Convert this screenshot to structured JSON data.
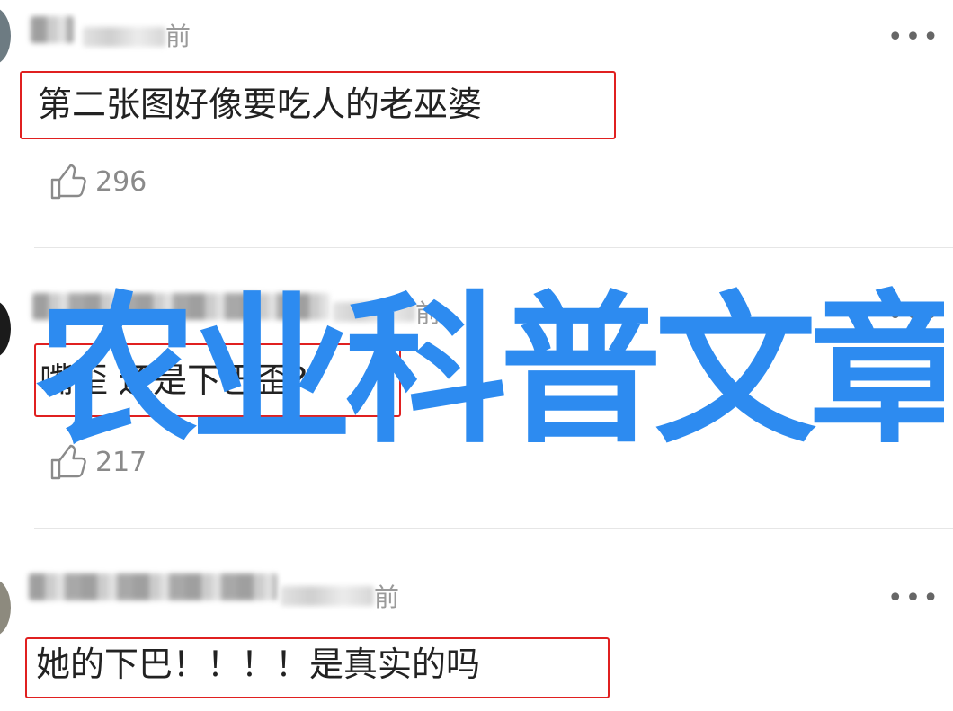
{
  "comments": [
    {
      "time_suffix": "前",
      "more_label": "•••",
      "text": "第二张图好像要吃人的老巫婆",
      "likes": "296"
    },
    {
      "time_suffix": "前",
      "more_label": "•••",
      "text": "嘴歪 还是下巴歪?",
      "likes": "217"
    },
    {
      "time_suffix": "前",
      "more_label": "•••",
      "text": "她的下巴！！！！是真实的吗",
      "likes": ""
    }
  ],
  "watermark": {
    "text": "农业科普文章",
    "color": "#2d8bf0"
  },
  "colors": {
    "highlight_border": "#e02020",
    "muted_text": "#9a9a9a"
  }
}
